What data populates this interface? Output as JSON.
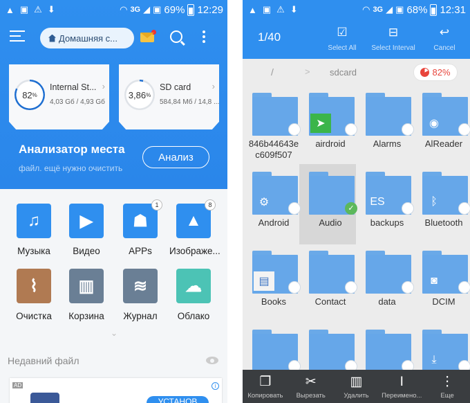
{
  "left": {
    "status": {
      "battery": "69%",
      "time": "12:29",
      "network": "3G"
    },
    "header": {
      "location": "Домашняя с..."
    },
    "storage": [
      {
        "percent": "82",
        "percent_unit": "%",
        "name": "Internal St...",
        "size": "4,03 Gб / 4,93 Gб",
        "ring_color": "#1f6fd1"
      },
      {
        "percent": "3,86",
        "percent_unit": "%",
        "name": "SD card",
        "size": "584,84 Мб / 14,8 ...",
        "ring_color": "#1f6fd1"
      }
    ],
    "analyzer": {
      "title": "Анализатор места",
      "subtitle": "файл. ещё нужно очистить",
      "button": "Анализ"
    },
    "categories": [
      {
        "label": "Музыка",
        "icon": "music-icon",
        "color": "#2f8fef"
      },
      {
        "label": "Видео",
        "icon": "video-icon",
        "color": "#2f8fef"
      },
      {
        "label": "APPs",
        "icon": "android-icon",
        "color": "#2f8fef",
        "badge": "1"
      },
      {
        "label": "Изображе...",
        "icon": "image-icon",
        "color": "#2f8fef",
        "badge": "8"
      },
      {
        "label": "Очистка",
        "icon": "broom-icon",
        "color": "#b07a52"
      },
      {
        "label": "Корзина",
        "icon": "trash-icon",
        "color": "#6a7f95"
      },
      {
        "label": "Журнал",
        "icon": "layers-icon",
        "color": "#6a7f95"
      },
      {
        "label": "Облако",
        "icon": "cloud-icon",
        "color": "#4cc3b5"
      }
    ],
    "recent_title": "Недавний файл",
    "ad": {
      "tag": "AD",
      "button": "УСТАНОВ"
    }
  },
  "right": {
    "status": {
      "battery": "68%",
      "time": "12:31",
      "network": "3G"
    },
    "selection": "1/40",
    "actions": [
      {
        "label": "Select All",
        "icon": "checkbox-icon"
      },
      {
        "label": "Select Interval",
        "icon": "interval-icon"
      },
      {
        "label": "Cancel",
        "icon": "undo-icon"
      }
    ],
    "breadcrumb": {
      "root": "/",
      "sep": ">",
      "current": "sdcard"
    },
    "storage_pill": "82%",
    "folders": [
      {
        "name": "846b44643ec609f507"
      },
      {
        "name": "airdroid",
        "overlay": "airdroid-icon"
      },
      {
        "name": "Alarms"
      },
      {
        "name": "AlReader",
        "overlay": "alreader-icon"
      },
      {
        "name": "Android",
        "overlay": "gear-icon"
      },
      {
        "name": "Audio",
        "selected": true
      },
      {
        "name": "backups",
        "overlay": "es-icon"
      },
      {
        "name": "Bluetooth",
        "overlay": "bluetooth-icon"
      },
      {
        "name": "Books",
        "overlay": "books-icon"
      },
      {
        "name": "Contact"
      },
      {
        "name": "data"
      },
      {
        "name": "DCIM",
        "overlay": "camera-icon"
      },
      {
        "name": ""
      },
      {
        "name": ""
      },
      {
        "name": ""
      },
      {
        "name": "",
        "overlay": "download-icon"
      }
    ],
    "bottom": [
      {
        "label": "Копировать",
        "icon": "copy-icon"
      },
      {
        "label": "Вырезать",
        "icon": "scissors-icon"
      },
      {
        "label": "Удалить",
        "icon": "trash-icon"
      },
      {
        "label": "Переимено...",
        "icon": "rename-icon"
      },
      {
        "label": "Еще",
        "icon": "more-icon"
      }
    ]
  }
}
